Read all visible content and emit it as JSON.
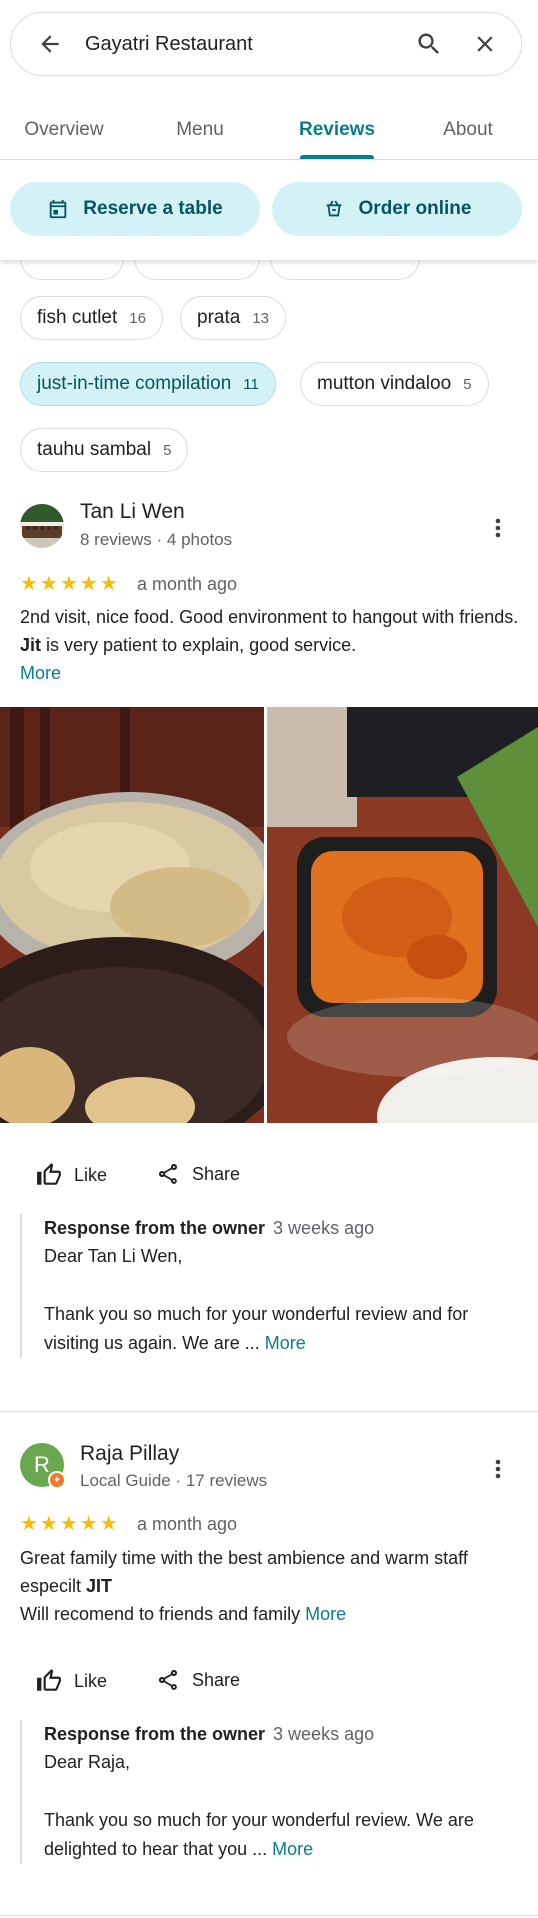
{
  "search": {
    "query": "Gayatri Restaurant"
  },
  "icons": {
    "back": "arrow-left-icon",
    "search": "search-icon",
    "close": "close-icon",
    "calendar": "calendar-icon",
    "bag": "shopping-bag-icon",
    "like": "thumb-up-icon",
    "share": "share-icon",
    "more": "more-vert-icon"
  },
  "tabs": [
    {
      "label": "Overview"
    },
    {
      "label": "Menu"
    },
    {
      "label": "Reviews"
    },
    {
      "label": "About"
    }
  ],
  "actions": {
    "reserve": "Reserve a table",
    "order": "Order online"
  },
  "chips": [
    {
      "label": "fish cutlet",
      "count": "16"
    },
    {
      "label": "prata",
      "count": "13"
    },
    {
      "label": "just-in-time compilation",
      "count": "11"
    },
    {
      "label": "mutton vindaloo",
      "count": "5"
    },
    {
      "label": "tauhu sambal",
      "count": "5"
    }
  ],
  "reviews": [
    {
      "name": "Tan Li Wen",
      "sub": "8 reviews · 4 photos",
      "stars": "★★★★★",
      "rating": 5,
      "when": "a month ago",
      "text_a": "2nd visit, nice food. Good environment to hangout with friends. ",
      "text_bold": "Jit",
      "text_b": " is very patient to explain, good service.",
      "more": "More",
      "like": "Like",
      "share": "Share",
      "owner_head": "Response from the owner",
      "owner_when": "3 weeks ago",
      "owner_greet": "Dear Tan Li Wen,",
      "owner_text": "Thank you so much for your wonderful review and for visiting us again. We are ... ",
      "owner_more": "More"
    },
    {
      "name": "Raja Pillay",
      "initial": "R",
      "sub": "Local Guide · 17 reviews",
      "stars": "★★★★★",
      "rating": 5,
      "when": "a month ago",
      "text_a": "Great family time with the best ambience and warm staff especilt ",
      "text_bold": "JIT",
      "text_b": "Will recomend to friends and family ",
      "more": "More",
      "like": "Like",
      "share": "Share",
      "owner_head": "Response from the owner",
      "owner_when": "3 weeks ago",
      "owner_greet": "Dear Raja,",
      "owner_text": "Thank you so much for your wonderful review. We are delighted to hear that you ... ",
      "owner_more": "More"
    }
  ],
  "colors": {
    "accent": "#0b7c8a",
    "chip_selected": "#d3f2f7",
    "star": "#fbbc04",
    "avatar_green": "#6aa84f",
    "local_guide_badge": "#f4772a"
  }
}
